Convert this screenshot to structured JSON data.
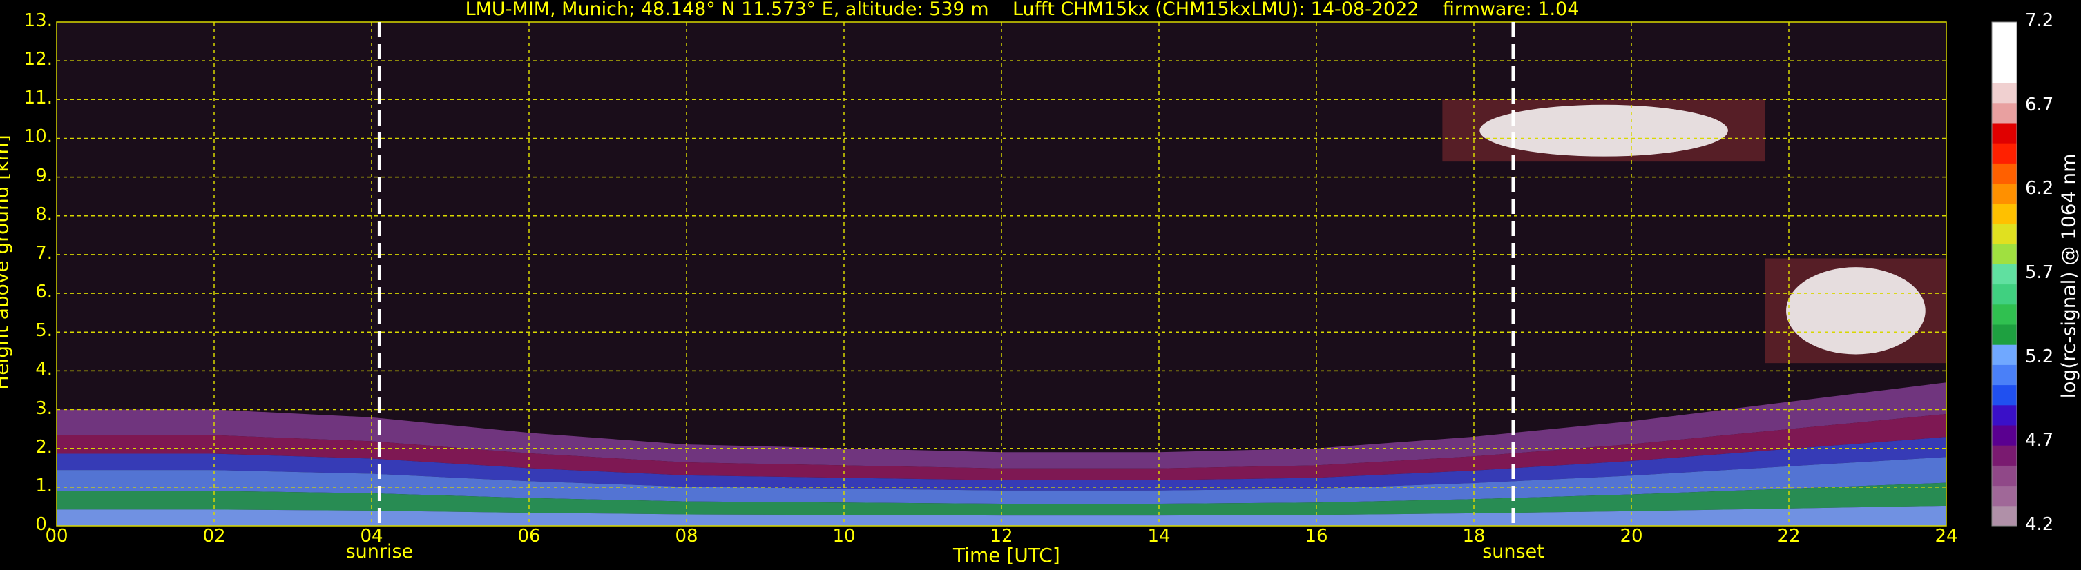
{
  "title": "LMU-MIM, Munich; 48.148° N 11.573° E, altitude: 539 m    Lufft CHM15kx (CHM15kxLMU): 14-08-2022    firmware: 1.04",
  "chart_data": {
    "type": "heatmap",
    "title": "LMU-MIM, Munich; 48.148° N 11.573° E, altitude: 539 m    Lufft CHM15kx (CHM15kxLMU): 14-08-2022    firmware: 1.04",
    "xlabel": "Time [UTC]",
    "ylabel": "Height above ground [km]",
    "xlim": [
      0,
      24
    ],
    "ylim": [
      0,
      13
    ],
    "x_ticks": [
      "00",
      "02",
      "04",
      "06",
      "08",
      "10",
      "12",
      "14",
      "16",
      "18",
      "20",
      "22",
      "24"
    ],
    "y_ticks": [
      "0.",
      "1.",
      "2.",
      "3.",
      "4.",
      "5.",
      "6.",
      "7.",
      "8.",
      "9.",
      "10.",
      "11.",
      "12.",
      "13."
    ],
    "grid": true,
    "colorbar": {
      "label": "log(rc-signal) @ 1064 nm",
      "range": [
        4.2,
        7.2
      ],
      "ticks": [
        "4.2",
        "4.7",
        "5.2",
        "5.7",
        "6.2",
        "6.7",
        "7.2"
      ]
    },
    "events": [
      {
        "label": "sunrise",
        "time": 4.1
      },
      {
        "label": "sunset",
        "time": 18.5
      }
    ],
    "cloud_layers": [
      {
        "t_start": 17.6,
        "t_end": 21.7,
        "h_bottom": 9.4,
        "h_top": 11.0
      },
      {
        "t_start": 21.7,
        "t_end": 24.0,
        "h_bottom": 4.2,
        "h_top": 6.9
      }
    ],
    "boundary_layer_top": [
      {
        "t": 0,
        "h": 3.0
      },
      {
        "t": 2,
        "h": 3.0
      },
      {
        "t": 4,
        "h": 2.8
      },
      {
        "t": 6,
        "h": 2.4
      },
      {
        "t": 8,
        "h": 2.1
      },
      {
        "t": 10,
        "h": 2.0
      },
      {
        "t": 12,
        "h": 1.9
      },
      {
        "t": 14,
        "h": 1.9
      },
      {
        "t": 16,
        "h": 2.0
      },
      {
        "t": 18,
        "h": 2.3
      },
      {
        "t": 20,
        "h": 2.7
      },
      {
        "t": 22,
        "h": 3.2
      },
      {
        "t": 24,
        "h": 3.7
      }
    ]
  }
}
